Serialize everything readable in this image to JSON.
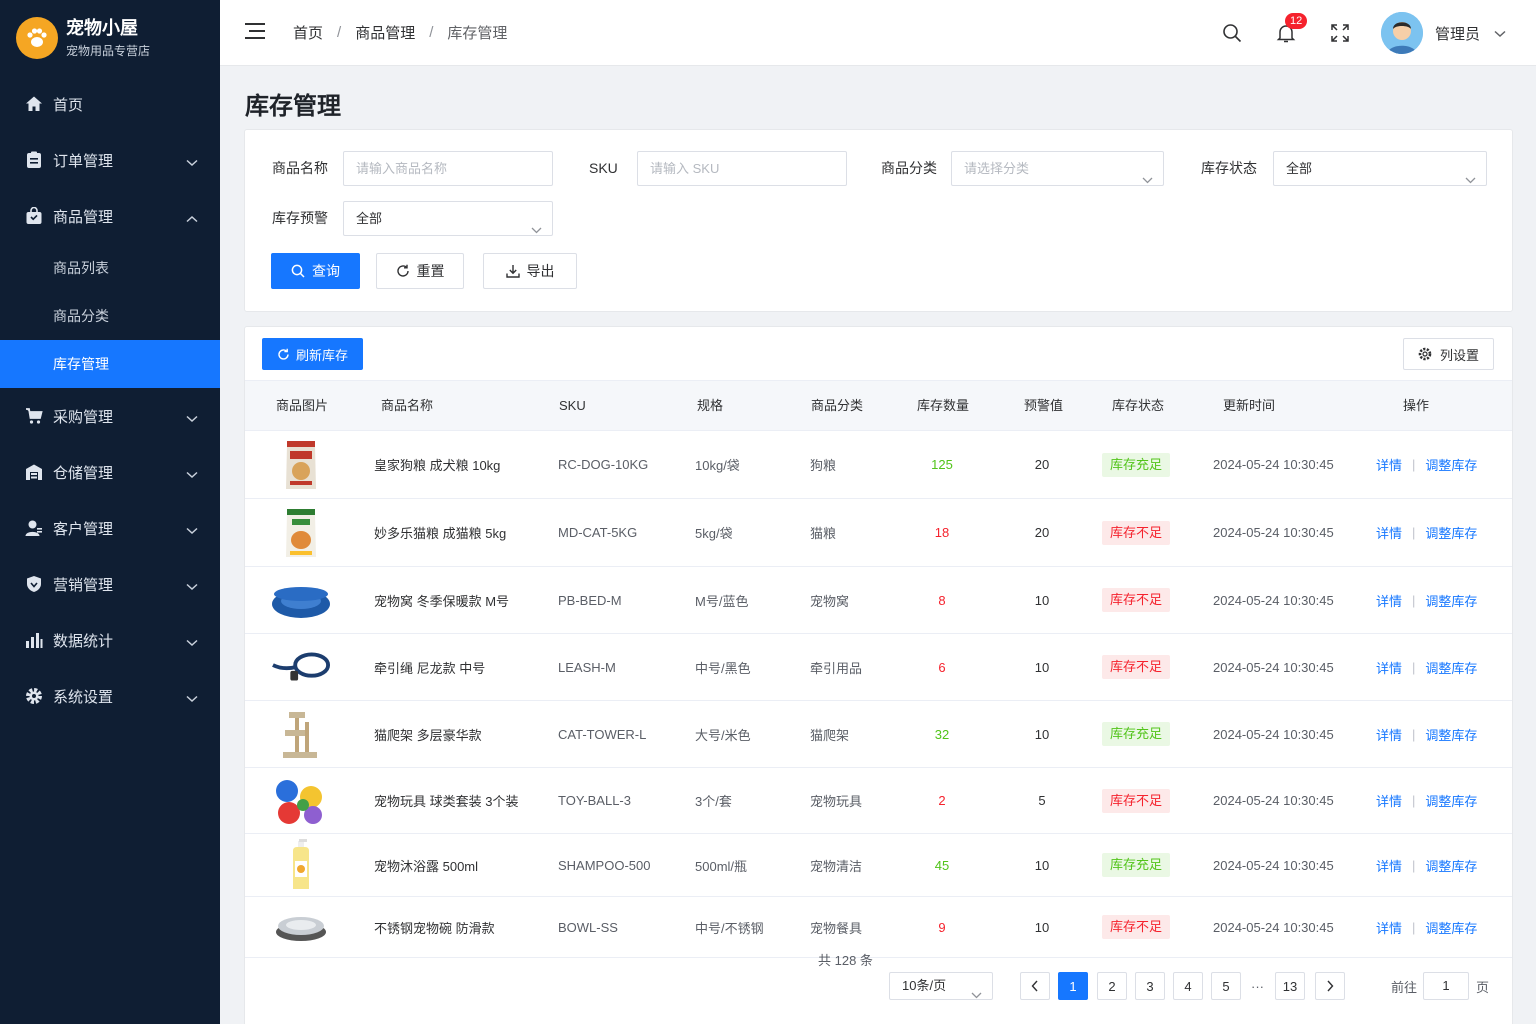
{
  "brand": {
    "title": "宠物小屋",
    "subtitle": "宠物用品专营店",
    "accent": "#f5a623"
  },
  "sidebar": {
    "items": [
      {
        "label": "首页",
        "icon": "home-icon"
      },
      {
        "label": "订单管理",
        "icon": "clipboard-icon"
      },
      {
        "label": "商品管理",
        "icon": "bag-icon",
        "expanded": true,
        "children": [
          {
            "label": "商品列表"
          },
          {
            "label": "商品分类"
          },
          {
            "label": "库存管理",
            "active": true
          }
        ]
      },
      {
        "label": "采购管理",
        "icon": "cart-icon"
      },
      {
        "label": "仓储管理",
        "icon": "warehouse-icon"
      },
      {
        "label": "客户管理",
        "icon": "user-icon"
      },
      {
        "label": "营销管理",
        "icon": "shield-icon"
      },
      {
        "label": "数据统计",
        "icon": "bar-chart-icon"
      },
      {
        "label": "系统设置",
        "icon": "gear-icon"
      }
    ]
  },
  "header": {
    "breadcrumb": [
      "首页",
      "商品管理",
      "库存管理"
    ],
    "separator": "/",
    "notifications": "12",
    "user": "管理员"
  },
  "page": {
    "title": "库存管理"
  },
  "filters": {
    "name_label": "商品名称",
    "name_placeholder": "请输入商品名称",
    "sku_label": "SKU",
    "sku_placeholder": "请输入 SKU",
    "category_label": "商品分类",
    "category_placeholder": "请选择分类",
    "status_label": "库存状态",
    "status_value": "全部",
    "alert_label": "库存预警",
    "alert_value": "全部",
    "search": "查询",
    "reset": "重置",
    "export": "导出"
  },
  "toolbar": {
    "refresh": "刷新库存",
    "columns": "列设置"
  },
  "table": {
    "headers": [
      "商品图片",
      "商品名称",
      "SKU",
      "规格",
      "商品分类",
      "库存数量",
      "预警值",
      "库存状态",
      "更新时间",
      "操作"
    ],
    "action_detail": "详情",
    "action_adjust": "调整库存",
    "rows": [
      {
        "img": "dog-food-bag",
        "name": "皇家狗粮 成犬粮 10kg",
        "sku": "RC-DOG-10KG",
        "spec": "10kg/袋",
        "category": "狗粮",
        "qty": "125",
        "alert": "20",
        "status": "库存充足",
        "ok": true,
        "updated": "2024-05-24 10:30:45"
      },
      {
        "img": "cat-food-bag",
        "name": "妙多乐猫粮 成猫粮 5kg",
        "sku": "MD-CAT-5KG",
        "spec": "5kg/袋",
        "category": "猫粮",
        "qty": "18",
        "alert": "20",
        "status": "库存不足",
        "ok": false,
        "updated": "2024-05-24 10:30:45"
      },
      {
        "img": "pet-bed",
        "name": "宠物窝 冬季保暖款 M号",
        "sku": "PB-BED-M",
        "spec": "M号/蓝色",
        "category": "宠物窝",
        "qty": "8",
        "alert": "10",
        "status": "库存不足",
        "ok": false,
        "updated": "2024-05-24 10:30:45"
      },
      {
        "img": "leash",
        "name": "牵引绳 尼龙款 中号",
        "sku": "LEASH-M",
        "spec": "中号/黑色",
        "category": "牵引用品",
        "qty": "6",
        "alert": "10",
        "status": "库存不足",
        "ok": false,
        "updated": "2024-05-24 10:30:45"
      },
      {
        "img": "cat-tower",
        "name": "猫爬架 多层豪华款",
        "sku": "CAT-TOWER-L",
        "spec": "大号/米色",
        "category": "猫爬架",
        "qty": "32",
        "alert": "10",
        "status": "库存充足",
        "ok": true,
        "updated": "2024-05-24 10:30:45"
      },
      {
        "img": "toy-balls",
        "name": "宠物玩具 球类套装 3个装",
        "sku": "TOY-BALL-3",
        "spec": "3个/套",
        "category": "宠物玩具",
        "qty": "2",
        "alert": "5",
        "status": "库存不足",
        "ok": false,
        "updated": "2024-05-24 10:30:45"
      },
      {
        "img": "shampoo-bottle",
        "name": "宠物沐浴露 500ml",
        "sku": "SHAMPOO-500",
        "spec": "500ml/瓶",
        "category": "宠物清洁",
        "qty": "45",
        "alert": "10",
        "status": "库存充足",
        "ok": true,
        "updated": "2024-05-24 10:30:45"
      },
      {
        "img": "steel-bowl",
        "name": "不锈钢宠物碗 防滑款",
        "sku": "BOWL-SS",
        "spec": "中号/不锈钢",
        "category": "宠物餐具",
        "qty": "9",
        "alert": "10",
        "status": "库存不足",
        "ok": false,
        "updated": "2024-05-24 10:30:45"
      }
    ]
  },
  "pagination": {
    "total": "共 128 条",
    "page_size": "10条/页",
    "pages": [
      "1",
      "2",
      "3",
      "4",
      "5"
    ],
    "ellipsis": "···",
    "last": "13",
    "current": "1",
    "goto_label": "前往",
    "goto_value": "1",
    "goto_suffix": "页"
  },
  "colors": {
    "primary": "#1677ff",
    "sidebar": "#0f1e33",
    "ok": "#52c41a",
    "low": "#f5222d"
  }
}
